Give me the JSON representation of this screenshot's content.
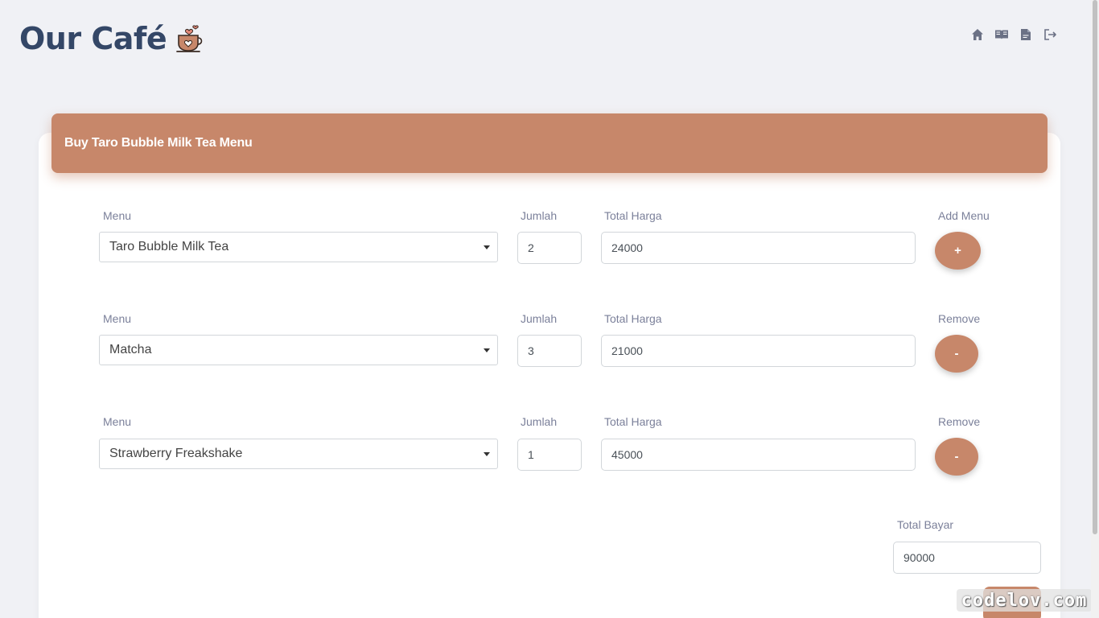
{
  "brand": {
    "title": "Our Café"
  },
  "nav": {
    "icons": [
      "home-icon",
      "book-icon",
      "receipt-icon",
      "logout-icon"
    ],
    "icon_color": "#6b7185"
  },
  "form": {
    "header_title": "Buy Taro Bubble Milk Tea Menu",
    "labels": {
      "menu": "Menu",
      "jumlah": "Jumlah",
      "total_harga": "Total Harga",
      "add_menu": "Add Menu",
      "remove": "Remove",
      "total_bayar": "Total Bayar"
    },
    "rows": [
      {
        "menu": "Taro Bubble Milk Tea",
        "jumlah": "2",
        "total_harga": "24000",
        "action_label": "Add Menu",
        "action_symbol": "+"
      },
      {
        "menu": "Matcha",
        "jumlah": "3",
        "total_harga": "21000",
        "action_label": "Remove",
        "action_symbol": "-"
      },
      {
        "menu": "Strawberry Freakshake",
        "jumlah": "1",
        "total_harga": "45000",
        "action_label": "Remove",
        "action_symbol": "-"
      }
    ],
    "total_bayar": "90000"
  },
  "watermark": "codelov.com",
  "colors": {
    "accent": "#c7876a",
    "title": "#344767",
    "background": "#f0f1f5"
  }
}
